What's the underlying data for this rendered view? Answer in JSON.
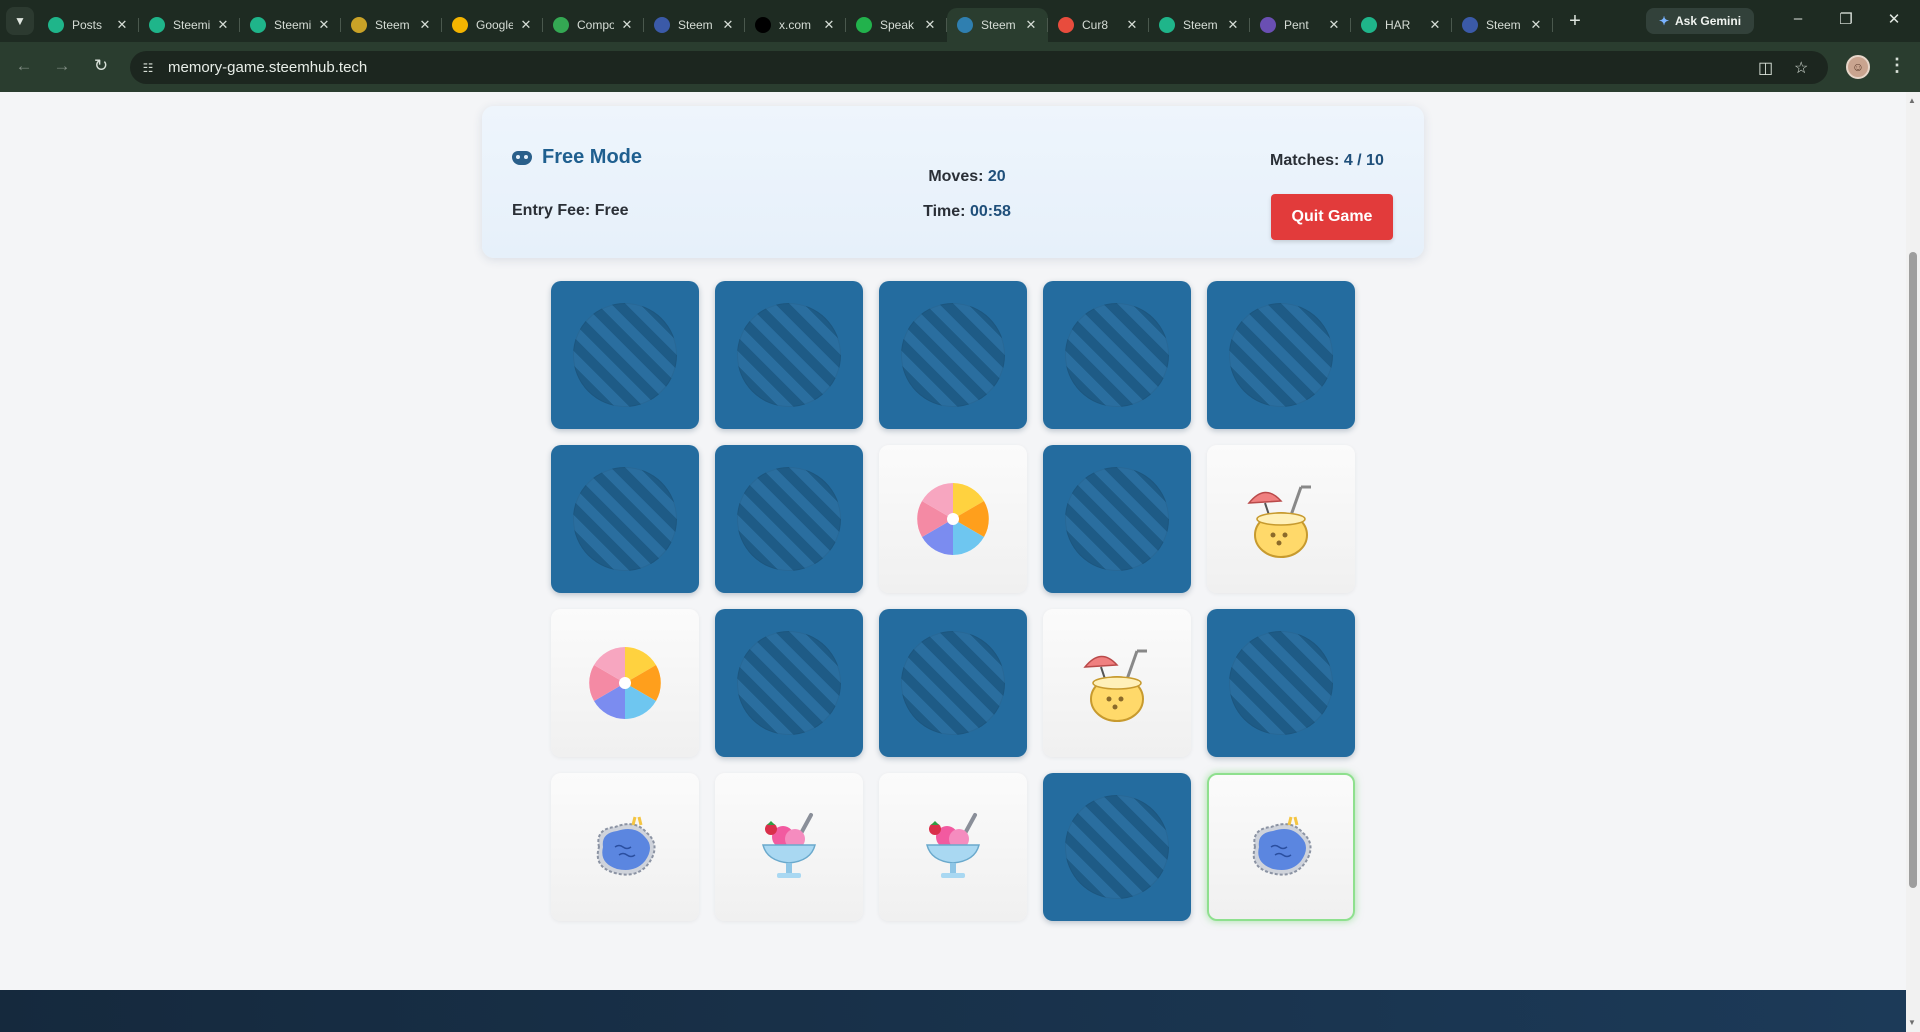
{
  "browser": {
    "tabs": [
      {
        "title": "Posts",
        "fav": "#1fb58a",
        "active": false
      },
      {
        "title": "Steemit",
        "fav": "#1fb58a",
        "active": false
      },
      {
        "title": "Steemit",
        "fav": "#1fb58a",
        "active": false
      },
      {
        "title": "Steem",
        "fav": "#c9a227",
        "active": false
      },
      {
        "title": "Google",
        "fav": "#f4b400",
        "active": false
      },
      {
        "title": "Compose",
        "fav": "#34a853",
        "active": false
      },
      {
        "title": "Steem",
        "fav": "#3b5aa8",
        "active": false
      },
      {
        "title": "x.com",
        "fav": "#000000",
        "active": false
      },
      {
        "title": "Speak",
        "fav": "#22b24c",
        "active": false
      },
      {
        "title": "Steem",
        "fav": "#2f7fb0",
        "active": true
      },
      {
        "title": "Cur8",
        "fav": "#e84c3d",
        "active": false
      },
      {
        "title": "Steem",
        "fav": "#1fb58a",
        "active": false
      },
      {
        "title": "Pent",
        "fav": "#6a4fb3",
        "active": false
      },
      {
        "title": "HAR",
        "fav": "#1fb58a",
        "active": false
      },
      {
        "title": "Steem",
        "fav": "#3b5aa8",
        "active": false
      }
    ],
    "ask_gemini": "Ask Gemini",
    "url": "memory-game.steemhub.tech"
  },
  "game": {
    "mode_label": "Free Mode",
    "entry_fee_label": "Entry Fee:",
    "entry_fee_value": "Free",
    "moves_label": "Moves:",
    "moves_value": "20",
    "time_label": "Time:",
    "time_value": "00:58",
    "matches_label": "Matches:",
    "matches_value": "4 / 10",
    "quit_label": "Quit Game"
  },
  "colors": {
    "card_back": "#246c9f",
    "quit_button": "#e23b3b",
    "accent_text": "#1f5f8f",
    "selected_glow": "#8ee08e"
  },
  "cards": [
    {
      "state": "hidden",
      "icon": ""
    },
    {
      "state": "hidden",
      "icon": ""
    },
    {
      "state": "hidden",
      "icon": ""
    },
    {
      "state": "hidden",
      "icon": ""
    },
    {
      "state": "hidden",
      "icon": ""
    },
    {
      "state": "hidden",
      "icon": ""
    },
    {
      "state": "hidden",
      "icon": ""
    },
    {
      "state": "revealed",
      "icon": "beach-ball-icon"
    },
    {
      "state": "hidden",
      "icon": ""
    },
    {
      "state": "revealed",
      "icon": "coconut-drink-icon"
    },
    {
      "state": "revealed",
      "icon": "beach-ball-icon"
    },
    {
      "state": "hidden",
      "icon": ""
    },
    {
      "state": "hidden",
      "icon": ""
    },
    {
      "state": "revealed",
      "icon": "coconut-drink-icon"
    },
    {
      "state": "hidden",
      "icon": ""
    },
    {
      "state": "revealed",
      "icon": "pool-icon"
    },
    {
      "state": "revealed",
      "icon": "ice-cream-sundae-icon"
    },
    {
      "state": "revealed",
      "icon": "ice-cream-sundae-icon"
    },
    {
      "state": "hidden",
      "icon": ""
    },
    {
      "state": "revealed",
      "icon": "pool-icon",
      "selected": true
    }
  ]
}
